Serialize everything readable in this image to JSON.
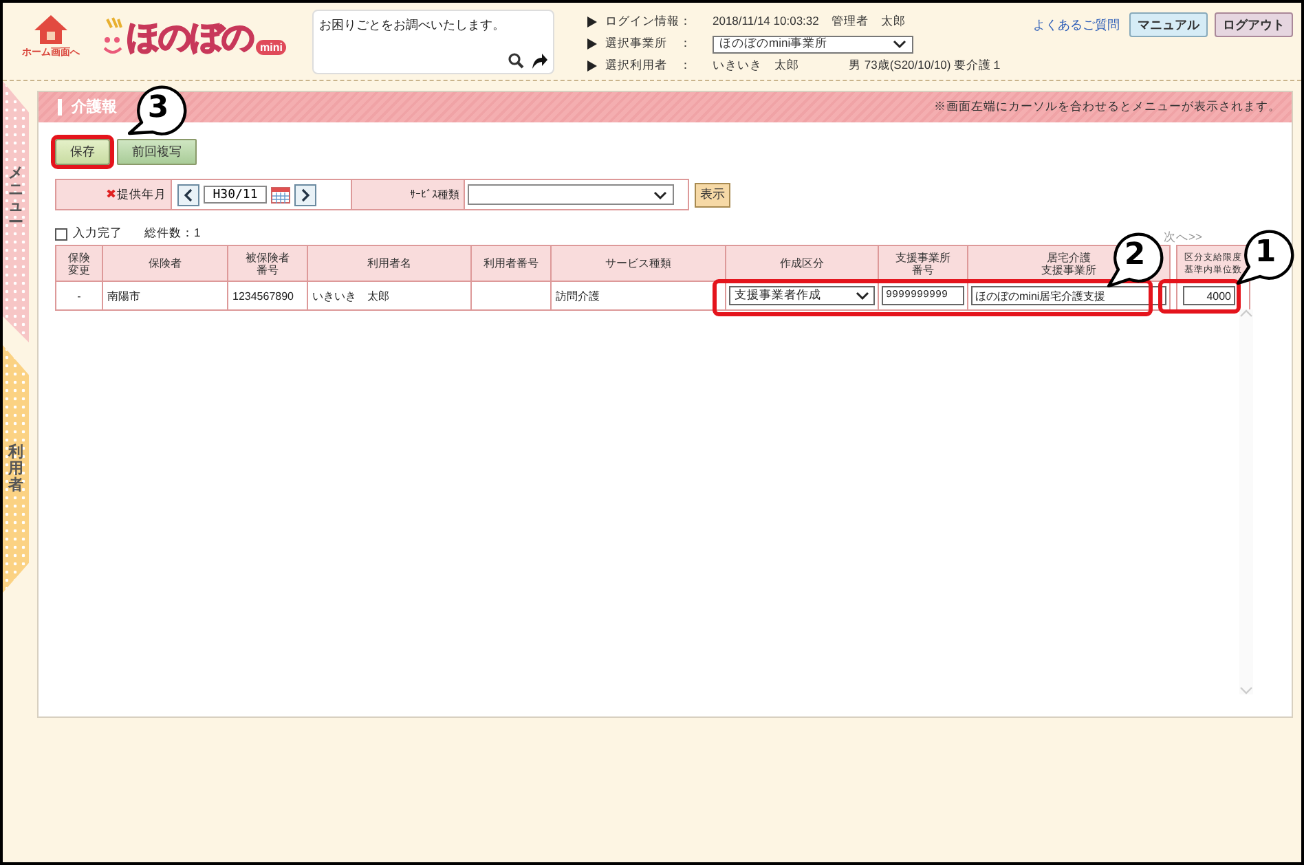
{
  "header": {
    "home_label": "ホーム画面へ",
    "logo": "ほのぼの",
    "logo_badge": "mini",
    "help_search": {
      "placeholder": "お困りごとをお調べいたします。"
    },
    "info": [
      {
        "kind": "text",
        "label": "ログイン情報：",
        "value": "2018/11/14 10:03:32　管理者　太郎"
      },
      {
        "kind": "select",
        "label": "選択事業所　：",
        "value": "ほのぼのmini事業所"
      },
      {
        "kind": "text",
        "label": "選択利用者　：",
        "value": "いきいき　太郎",
        "extra": "男 73歳(S20/10/10) 要介護１"
      }
    ],
    "faq_link": "よくあるご質問",
    "buttons": [
      {
        "kind": "manual",
        "label": "マニュアル"
      },
      {
        "kind": "logout",
        "label": "ログアウト"
      }
    ]
  },
  "sidebar": [
    {
      "kind": "menu",
      "label": "メニュー"
    },
    {
      "kind": "user",
      "label": "利用者"
    }
  ],
  "page_title": "介護報",
  "notice": "※画面左端にカーソルを合わせるとメニューが表示されます。",
  "actions": [
    {
      "label": "保存",
      "highlighted": true
    },
    {
      "label": "前回複写",
      "highlighted": false
    }
  ],
  "filter": {
    "required_mark": "✖",
    "month_label": "提供年月",
    "month_value": "H30/11",
    "service_label": "ｻｰﾋﾞｽ種類",
    "show_button": "表示"
  },
  "complete_checkbox": {
    "label": "入力完了",
    "checked": false
  },
  "total": "総件数：1",
  "pager": "次へ>>",
  "table": {
    "columns": [
      {
        "lines": [
          "保険",
          "変更"
        ]
      },
      {
        "lines": [
          "保険者"
        ]
      },
      {
        "lines": [
          "被保険者",
          "番号"
        ]
      },
      {
        "lines": [
          "利用者名"
        ]
      },
      {
        "lines": [
          "利用者番号"
        ]
      },
      {
        "lines": [
          "サービス種類"
        ]
      },
      {
        "lines": [
          "作成区分"
        ]
      },
      {
        "lines": [
          "支援事業所",
          "番号"
        ]
      },
      {
        "lines": [
          "居宅介護",
          "支援事業所"
        ]
      },
      {
        "lines": [
          "区分支給限度",
          "基準内単位数"
        ]
      }
    ],
    "rows": [
      [
        {
          "kind": "text",
          "value": "-"
        },
        {
          "kind": "text",
          "value": "南陽市"
        },
        {
          "kind": "text",
          "value": "1234567890"
        },
        {
          "kind": "text",
          "value": "いきいき　太郎"
        },
        {
          "kind": "text"
        },
        {
          "kind": "text",
          "value": "訪問介護"
        },
        {
          "kind": "select",
          "value": "支援事業者作成"
        },
        {
          "kind": "input",
          "value": "9999999999"
        },
        {
          "kind": "input",
          "value": "ほのぼのmini居宅介護支援"
        },
        {
          "kind": "input",
          "value": "4000"
        }
      ]
    ]
  },
  "callouts": [
    {
      "number": "1"
    },
    {
      "number": "2"
    },
    {
      "number": "3"
    }
  ]
}
